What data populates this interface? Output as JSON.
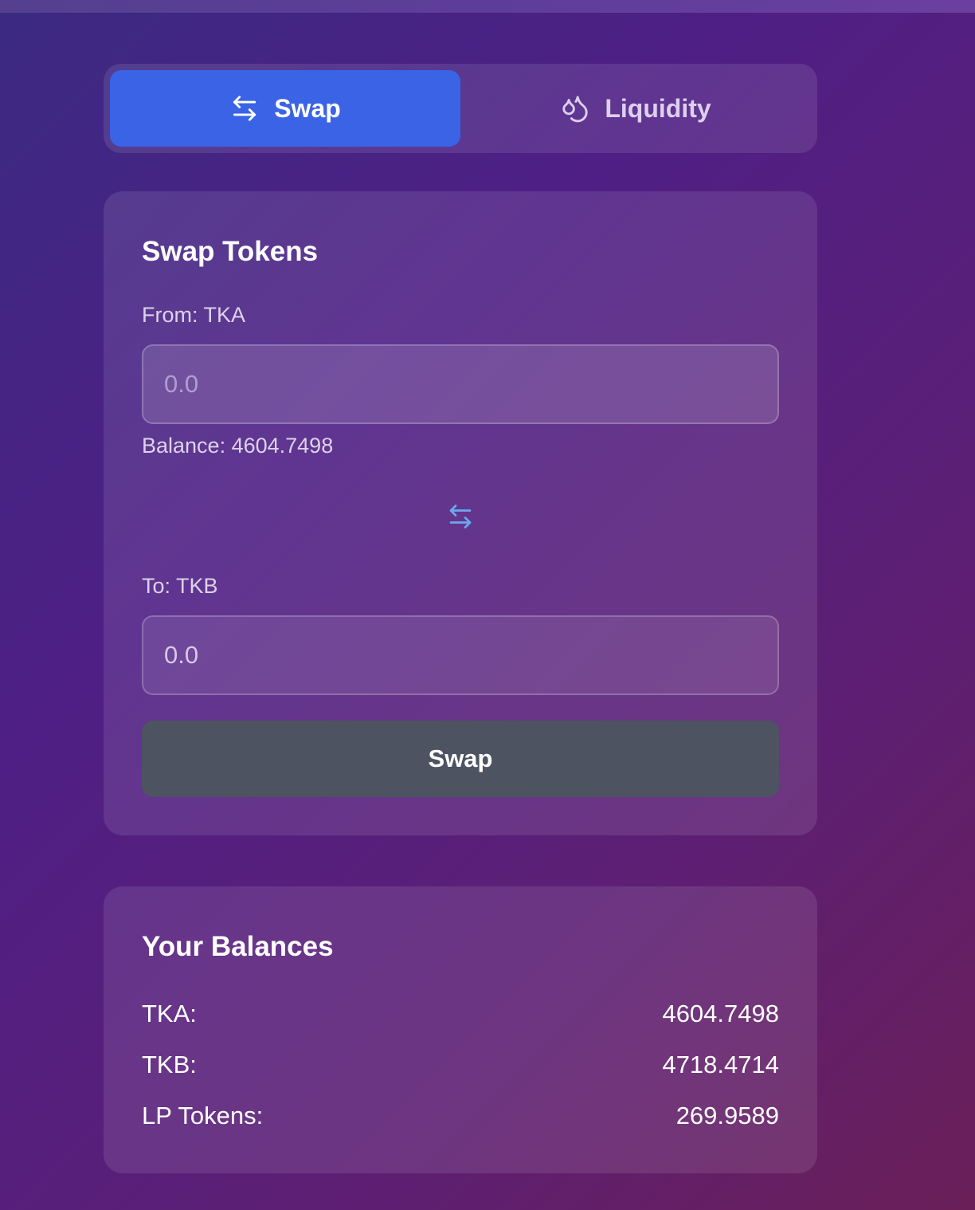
{
  "tabs": [
    {
      "label": "Swap",
      "icon": "swap-arrows-icon",
      "active": true
    },
    {
      "label": "Liquidity",
      "icon": "droplets-icon",
      "active": false
    }
  ],
  "swap_card": {
    "title": "Swap Tokens",
    "from_label": "From: TKA",
    "from_placeholder": "0.0",
    "balance_text": "Balance: 4604.7498",
    "to_label": "To: TKB",
    "to_value": "0.0",
    "button_label": "Swap"
  },
  "balances": {
    "title": "Your Balances",
    "rows": [
      {
        "label": "TKA:",
        "value": "4604.7498"
      },
      {
        "label": "TKB:",
        "value": "4718.4714"
      },
      {
        "label": "LP Tokens:",
        "value": "269.9589"
      }
    ]
  },
  "colors": {
    "active_tab": "#3a63e6",
    "swap_button": "#4d5361",
    "swap_direction_icon": "#6aa8f0"
  }
}
